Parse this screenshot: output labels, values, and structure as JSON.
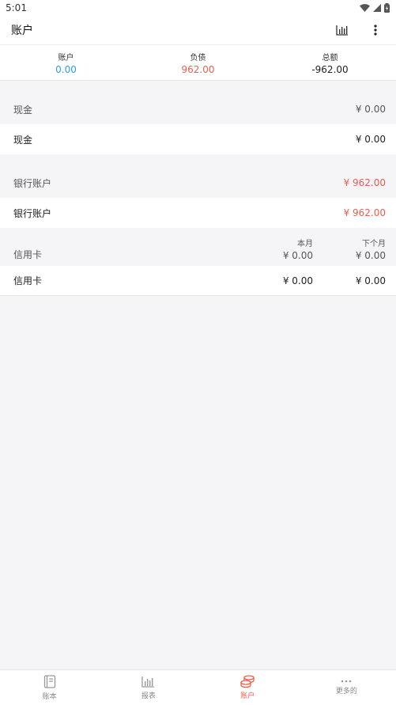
{
  "status_bar": {
    "time": "5:01"
  },
  "app_bar": {
    "title": "账户"
  },
  "summary": {
    "account_label": "账户",
    "account_value": "0.00",
    "debt_label": "负债",
    "debt_value": "962.00",
    "total_label": "总额",
    "total_value": "-962.00"
  },
  "sections": {
    "cash": {
      "header": "现金",
      "header_amount": "¥ 0.00",
      "item": "现金",
      "item_amount": "¥ 0.00"
    },
    "bank": {
      "header": "银行账户",
      "header_amount": "¥ 962.00",
      "item": "银行账户",
      "item_amount": "¥ 962.00"
    },
    "credit": {
      "header": "信用卡",
      "this_month_label": "本月",
      "next_month_label": "下个月",
      "header_this_month": "¥ 0.00",
      "header_next_month": "¥ 0.00",
      "item": "信用卡",
      "item_this_month": "¥ 0.00",
      "item_next_month": "¥ 0.00"
    }
  },
  "bottom_nav": {
    "items": [
      {
        "label": "账本",
        "icon": "book-icon"
      },
      {
        "label": "报表",
        "icon": "bar-chart-icon"
      },
      {
        "label": "账户",
        "icon": "coins-icon",
        "active": true
      },
      {
        "label": "更多的",
        "icon": "more-dots-icon"
      }
    ]
  },
  "colors": {
    "accent": "#e8604c",
    "blue": "#2e9be6"
  }
}
